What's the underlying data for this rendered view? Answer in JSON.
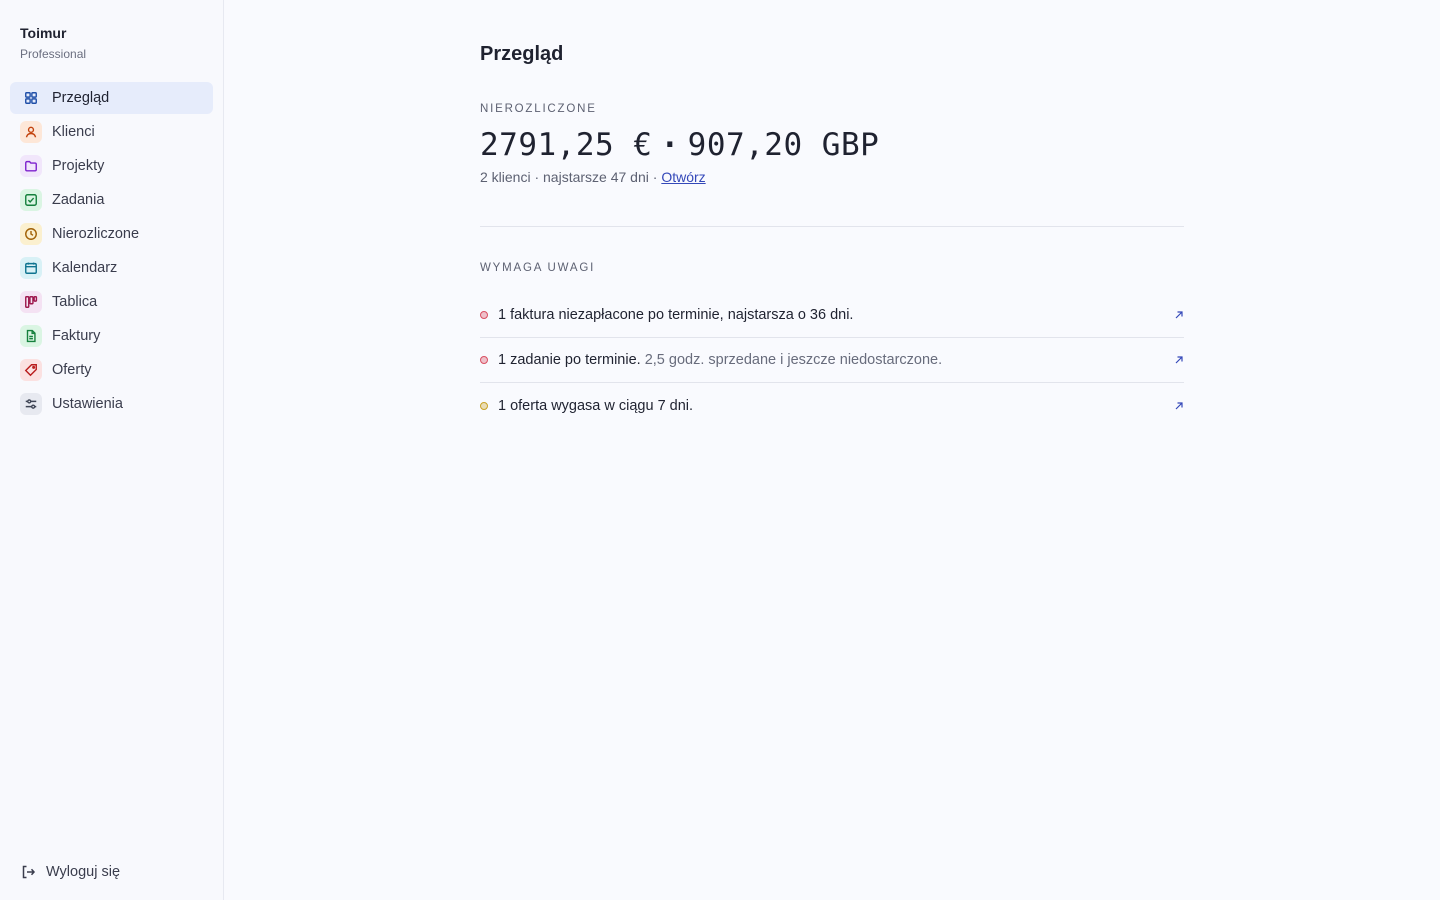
{
  "brand": {
    "name": "Toimur",
    "plan": "Professional"
  },
  "nav": [
    {
      "label": "Przegląd",
      "icon": "grid-icon",
      "color": "#1f4fa8",
      "bg": "#e6ecfb"
    },
    {
      "label": "Klienci",
      "icon": "user-icon",
      "color": "#c2410c",
      "bg": "#fde7d8"
    },
    {
      "label": "Projekty",
      "icon": "folder-icon",
      "color": "#7e22ce",
      "bg": "#f1e6fb"
    },
    {
      "label": "Zadania",
      "icon": "check-square-icon",
      "color": "#15803d",
      "bg": "#daf5e3"
    },
    {
      "label": "Nierozliczone",
      "icon": "clock-icon",
      "color": "#a16207",
      "bg": "#fbf0cf"
    },
    {
      "label": "Kalendarz",
      "icon": "calendar-icon",
      "color": "#0e7490",
      "bg": "#d8f1f6"
    },
    {
      "label": "Tablica",
      "icon": "kanban-icon",
      "color": "#9d174d",
      "bg": "#f4e2f3"
    },
    {
      "label": "Faktury",
      "icon": "invoice-icon",
      "color": "#15803d",
      "bg": "#daf5e3"
    },
    {
      "label": "Oferty",
      "icon": "tag-icon",
      "color": "#b91c1c",
      "bg": "#fbe1e1"
    },
    {
      "label": "Ustawienia",
      "icon": "sliders-icon",
      "color": "#3f4555",
      "bg": "#e7e9f0"
    }
  ],
  "logout_label": "Wyloguj się",
  "page": {
    "title": "Przegląd",
    "unbilled": {
      "label": "NIEROZLICZONE",
      "amount_eur": "2791,25 €",
      "separator": "·",
      "amount_gbp": "907,20 GBP",
      "meta": "2 klienci · najstarsze 47 dni · ",
      "link": "Otwórz"
    },
    "attention": {
      "label": "WYMAGA UWAGI",
      "items": [
        {
          "text": "1 faktura niezapłacone po terminie, najstarsza o 36 dni.",
          "sub": "",
          "dot_color": "#d94f62"
        },
        {
          "text": "1 zadanie po terminie.",
          "sub": " 2,5 godz. sprzedane i jeszcze niedostarczone.",
          "dot_color": "#d94f62"
        },
        {
          "text": "1 oferta wygasa w ciągu 7 dni.",
          "sub": "",
          "dot_color": "#c9a227"
        }
      ]
    }
  },
  "accent_color": "#3448b9"
}
